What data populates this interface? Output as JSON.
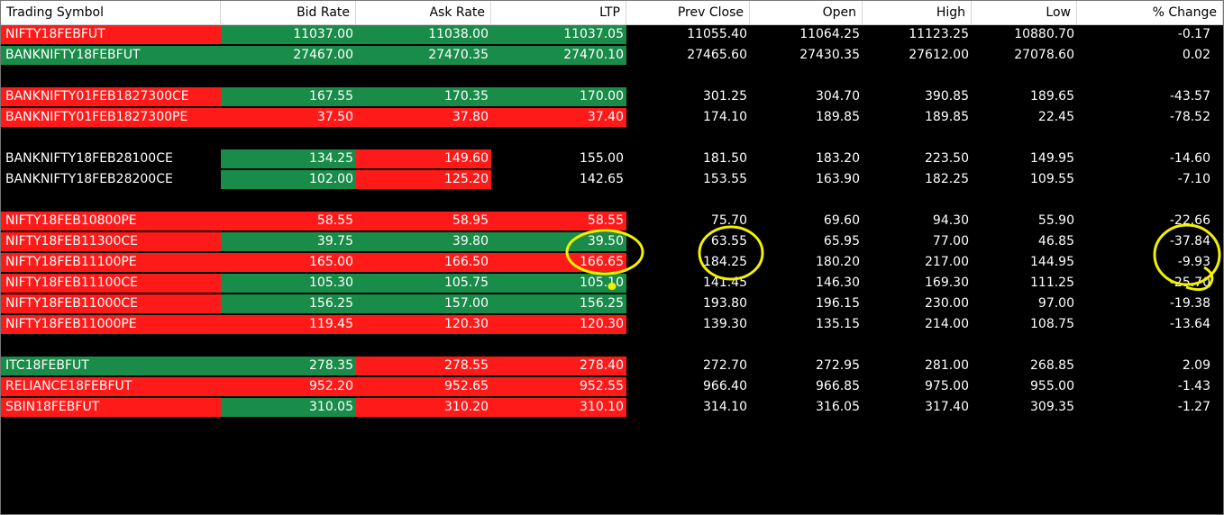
{
  "header": {
    "columns": [
      "Trading Symbol",
      "Bid Rate",
      "Ask Rate",
      "LTP",
      "Prev Close",
      "Open",
      "High",
      "Low",
      "% Change"
    ]
  },
  "colors": {
    "red": "#ff1a1a",
    "green": "#1a8c4a",
    "black": "#000000",
    "highlight": "#f2f200"
  },
  "rows": [
    {
      "slot": 0,
      "cells": [
        "NIFTY18FEBFUT",
        "11037.00",
        "11038.00",
        "11037.05",
        "11055.40",
        "11064.25",
        "11123.25",
        "10880.70",
        "-0.17"
      ],
      "colors": [
        "red",
        "green",
        "green",
        "green"
      ]
    },
    {
      "slot": 1,
      "cells": [
        "BANKNIFTY18FEBFUT",
        "27467.00",
        "27470.35",
        "27470.10",
        "27465.60",
        "27430.35",
        "27612.00",
        "27078.60",
        "0.02"
      ],
      "colors": [
        "green",
        "green",
        "green",
        "green"
      ]
    },
    {
      "slot": 3,
      "cells": [
        "BANKNIFTY01FEB1827300CE",
        "167.55",
        "170.35",
        "170.00",
        "301.25",
        "304.70",
        "390.85",
        "189.65",
        "-43.57"
      ],
      "colors": [
        "red",
        "green",
        "green",
        "green"
      ]
    },
    {
      "slot": 4,
      "cells": [
        "BANKNIFTY01FEB1827300PE",
        "37.50",
        "37.80",
        "37.40",
        "174.10",
        "189.85",
        "189.85",
        "22.45",
        "-78.52"
      ],
      "colors": [
        "red",
        "red",
        "red",
        "red"
      ]
    },
    {
      "slot": 6,
      "cells": [
        "BANKNIFTY18FEB28100CE",
        "134.25",
        "149.60",
        "155.00",
        "181.50",
        "183.20",
        "223.50",
        "149.95",
        "-14.60"
      ],
      "colors": [
        "black",
        "green",
        "red",
        "black"
      ]
    },
    {
      "slot": 7,
      "cells": [
        "BANKNIFTY18FEB28200CE",
        "102.00",
        "125.20",
        "142.65",
        "153.55",
        "163.90",
        "182.25",
        "109.55",
        "-7.10"
      ],
      "colors": [
        "black",
        "green",
        "red",
        "black"
      ]
    },
    {
      "slot": 9,
      "cells": [
        "NIFTY18FEB10800PE",
        "58.55",
        "58.95",
        "58.55",
        "75.70",
        "69.60",
        "94.30",
        "55.90",
        "-22.66"
      ],
      "colors": [
        "red",
        "red",
        "red",
        "red"
      ]
    },
    {
      "slot": 10,
      "cells": [
        "NIFTY18FEB11300CE",
        "39.75",
        "39.80",
        "39.50",
        "63.55",
        "65.95",
        "77.00",
        "46.85",
        "-37.84"
      ],
      "colors": [
        "red",
        "green",
        "green",
        "green"
      ]
    },
    {
      "slot": 11,
      "cells": [
        "NIFTY18FEB11100PE",
        "165.00",
        "166.50",
        "166.65",
        "184.25",
        "180.20",
        "217.00",
        "144.95",
        "-9.93"
      ],
      "colors": [
        "red",
        "red",
        "red",
        "red"
      ]
    },
    {
      "slot": 12,
      "cells": [
        "NIFTY18FEB11100CE",
        "105.30",
        "105.75",
        "105.10",
        "141.45",
        "146.30",
        "169.30",
        "111.25",
        "-25.70"
      ],
      "colors": [
        "red",
        "green",
        "green",
        "green"
      ]
    },
    {
      "slot": 13,
      "cells": [
        "NIFTY18FEB11000CE",
        "156.25",
        "157.00",
        "156.25",
        "193.80",
        "196.15",
        "230.00",
        "97.00",
        "-19.38"
      ],
      "colors": [
        "red",
        "green",
        "green",
        "green"
      ]
    },
    {
      "slot": 14,
      "cells": [
        "NIFTY18FEB11000PE",
        "119.45",
        "120.30",
        "120.30",
        "139.30",
        "135.15",
        "214.00",
        "108.75",
        "-13.64"
      ],
      "colors": [
        "red",
        "red",
        "red",
        "red"
      ]
    },
    {
      "slot": 16,
      "cells": [
        "ITC18FEBFUT",
        "278.35",
        "278.55",
        "278.40",
        "272.70",
        "272.95",
        "281.00",
        "268.85",
        "2.09"
      ],
      "colors": [
        "green",
        "green",
        "red",
        "red"
      ]
    },
    {
      "slot": 17,
      "cells": [
        "RELIANCE18FEBFUT",
        "952.20",
        "952.65",
        "952.55",
        "966.40",
        "966.85",
        "975.00",
        "955.00",
        "-1.43"
      ],
      "colors": [
        "red",
        "red",
        "red",
        "red"
      ]
    },
    {
      "slot": 18,
      "cells": [
        "SBIN18FEBFUT",
        "310.05",
        "310.20",
        "310.10",
        "314.10",
        "316.05",
        "317.40",
        "309.35",
        "-1.27"
      ],
      "colors": [
        "red",
        "green",
        "red",
        "red"
      ]
    }
  ]
}
